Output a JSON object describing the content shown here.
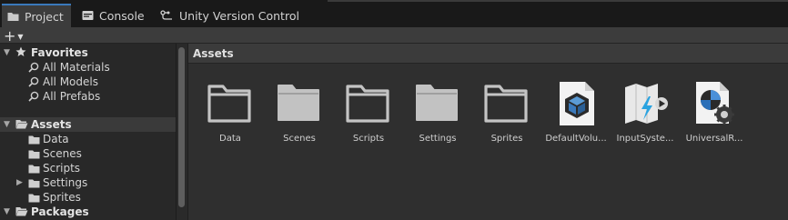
{
  "tabs": [
    {
      "label": "Project",
      "icon": "folder-icon"
    },
    {
      "label": "Console",
      "icon": "console-icon"
    },
    {
      "label": "Unity Version Control",
      "icon": "version-control-icon"
    }
  ],
  "toolbar": {
    "create_label": "+",
    "create_icon": "plus-icon"
  },
  "tree": {
    "favorites_label": "Favorites",
    "favorites_items": [
      "All Materials",
      "All Models",
      "All Prefabs"
    ],
    "assets_label": "Assets",
    "assets_items": [
      "Data",
      "Scenes",
      "Scripts",
      "Settings",
      "Sprites"
    ],
    "packages_label": "Packages"
  },
  "breadcrumb": "Assets",
  "assets": [
    {
      "name": "Data",
      "icon": "folder-outline-icon"
    },
    {
      "name": "Scenes",
      "icon": "folder-filled-icon"
    },
    {
      "name": "Scripts",
      "icon": "folder-outline-icon"
    },
    {
      "name": "Settings",
      "icon": "folder-filled-icon"
    },
    {
      "name": "Sprites",
      "icon": "folder-outline-icon"
    },
    {
      "name": "DefaultVolu...",
      "icon": "volume-profile-icon"
    },
    {
      "name": "InputSyste...",
      "icon": "input-actions-icon"
    },
    {
      "name": "UniversalR...",
      "icon": "render-pipeline-asset-icon"
    }
  ],
  "colors": {
    "accent": "#3a79bb",
    "background": "#282828",
    "panel": "#2f2f2f",
    "selected_row": "#3a3a3a"
  }
}
